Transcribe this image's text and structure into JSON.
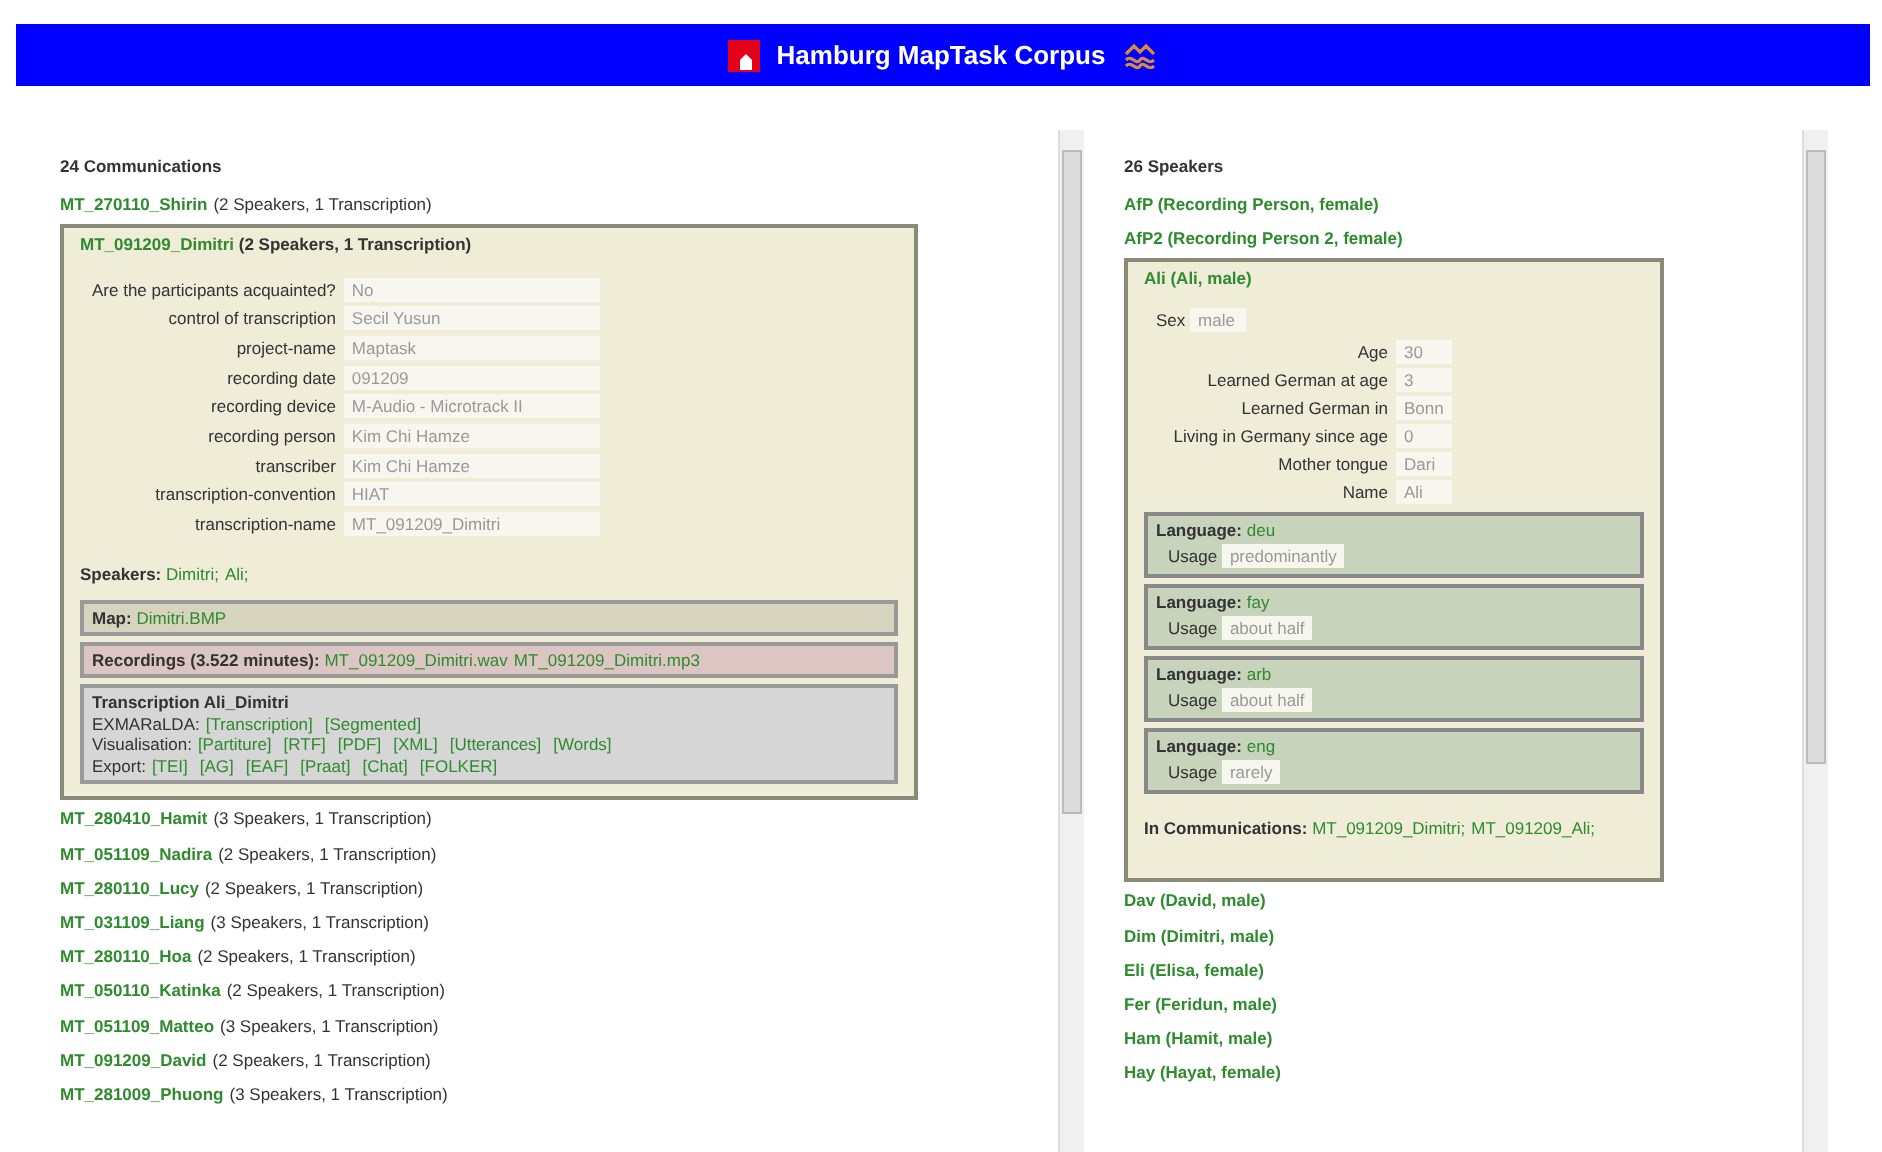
{
  "header": {
    "title": "Hamburg MapTask Corpus"
  },
  "communications": {
    "heading": "24 Communications",
    "items": [
      {
        "name": "MT_270110_Shirin",
        "info": "(2 Speakers, 1 Transcription)"
      },
      {
        "name": "MT_091209_Dimitri",
        "info": "(2 Speakers, 1 Transcription)",
        "details": {
          "attributes": [
            {
              "label": "Are the participants acquainted?",
              "value": "No"
            },
            {
              "label": "control of transcription",
              "value": "Secil Yusun"
            },
            {
              "label": "project-name",
              "value": "Maptask"
            },
            {
              "label": "recording date",
              "value": "091209"
            },
            {
              "label": "recording device",
              "value": "M-Audio - Microtrack II"
            },
            {
              "label": "recording person",
              "value": "Kim Chi Hamze"
            },
            {
              "label": "transcriber",
              "value": "Kim Chi Hamze"
            },
            {
              "label": "transcription-convention",
              "value": "HIAT"
            },
            {
              "label": "transcription-name",
              "value": "MT_091209_Dimitri"
            }
          ],
          "speakers": {
            "label": "Speakers:",
            "links": [
              "Dimitri;",
              "Ali;"
            ]
          },
          "map": {
            "label": "Map:",
            "links": [
              "Dimitri.BMP"
            ]
          },
          "recordings": {
            "label": "Recordings (3.522 minutes):",
            "links": [
              "MT_091209_Dimitri.wav",
              "MT_091209_Dimitri.mp3"
            ]
          },
          "transcription": {
            "title": "Transcription Ali_Dimitri",
            "lines": [
              {
                "label": "EXMARaLDA:",
                "links": [
                  "[Transcription]",
                  "[Segmented]"
                ]
              },
              {
                "label": "Visualisation:",
                "links": [
                  "[Partiture]",
                  "[RTF]",
                  "[PDF]",
                  "[XML]",
                  "[Utterances]",
                  "[Words]"
                ]
              },
              {
                "label": "Export:",
                "links": [
                  "[TEI]",
                  "[AG]",
                  "[EAF]",
                  "[Praat]",
                  "[Chat]",
                  "[FOLKER]"
                ]
              }
            ]
          }
        }
      },
      {
        "name": "MT_280410_Hamit",
        "info": "(3 Speakers, 1 Transcription)"
      },
      {
        "name": "MT_051109_Nadira",
        "info": "(2 Speakers, 1 Transcription)"
      },
      {
        "name": "MT_280110_Lucy",
        "info": "(2 Speakers, 1 Transcription)"
      },
      {
        "name": "MT_031109_Liang",
        "info": "(3 Speakers, 1 Transcription)"
      },
      {
        "name": "MT_280110_Hoa",
        "info": "(2 Speakers, 1 Transcription)"
      },
      {
        "name": "MT_050110_Katinka",
        "info": "(2 Speakers, 1 Transcription)"
      },
      {
        "name": "MT_051109_Matteo",
        "info": "(3 Speakers, 1 Transcription)"
      },
      {
        "name": "MT_091209_David",
        "info": "(2 Speakers, 1 Transcription)"
      },
      {
        "name": "MT_281009_Phuong",
        "info": "(3 Speakers, 1 Transcription)"
      }
    ]
  },
  "speakers": {
    "heading": "26 Speakers",
    "items": [
      {
        "name": "AfP (Recording Person, female)"
      },
      {
        "name": "AfP2 (Recording Person 2, female)"
      },
      {
        "name": "Ali (Ali, male)",
        "details": {
          "sex": {
            "label": "Sex",
            "value": "male"
          },
          "attributes": [
            {
              "label": "Age",
              "value": "30"
            },
            {
              "label": "Learned German at age",
              "value": "3"
            },
            {
              "label": "Learned German in",
              "value": "Bonn"
            },
            {
              "label": "Living in Germany since age",
              "value": "0"
            },
            {
              "label": "Mother tongue",
              "value": "Dari"
            },
            {
              "label": "Name",
              "value": "Ali"
            }
          ],
          "languages": [
            {
              "label": "Language:",
              "code": "deu",
              "usage_label": "Usage",
              "usage": "predominantly"
            },
            {
              "label": "Language:",
              "code": "fay",
              "usage_label": "Usage",
              "usage": "about half"
            },
            {
              "label": "Language:",
              "code": "arb",
              "usage_label": "Usage",
              "usage": "about half"
            },
            {
              "label": "Language:",
              "code": "eng",
              "usage_label": "Usage",
              "usage": "rarely"
            }
          ],
          "communications": {
            "label": "In Communications:",
            "links": [
              "MT_091209_Dimitri;",
              "MT_091209_Ali;"
            ]
          }
        }
      },
      {
        "name": "Dav (David, male)"
      },
      {
        "name": "Dim (Dimitri, male)"
      },
      {
        "name": "Eli (Elisa, female)"
      },
      {
        "name": "Fer (Feridun, male)"
      },
      {
        "name": "Ham (Hamit, male)"
      },
      {
        "name": "Hay (Hayat, female)"
      }
    ]
  }
}
